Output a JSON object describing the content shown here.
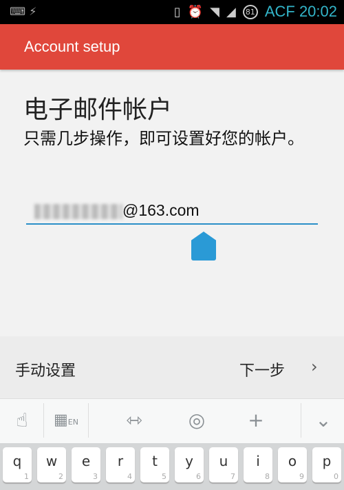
{
  "status": {
    "carrier": "ACF",
    "time": "20:02",
    "battery": "81"
  },
  "appbar": {
    "title": "Account setup"
  },
  "main": {
    "title": "电子邮件帐户",
    "subtitle": "只需几步操作，即可设置好您的帐户。",
    "email_domain": "@163.com"
  },
  "bottom": {
    "manual": "手动设置",
    "next": "下一步"
  },
  "keyboard": {
    "lang": "EN",
    "keys": [
      {
        "c": "q",
        "n": "1"
      },
      {
        "c": "w",
        "n": "2"
      },
      {
        "c": "e",
        "n": "3"
      },
      {
        "c": "r",
        "n": "4"
      },
      {
        "c": "t",
        "n": "5"
      },
      {
        "c": "y",
        "n": "6"
      },
      {
        "c": "u",
        "n": "7"
      },
      {
        "c": "i",
        "n": "8"
      },
      {
        "c": "o",
        "n": "9"
      },
      {
        "c": "p",
        "n": "0"
      }
    ]
  },
  "colors": {
    "accent": "#e0473b",
    "input": "#2a8fc8",
    "clock": "#33b5c9"
  }
}
